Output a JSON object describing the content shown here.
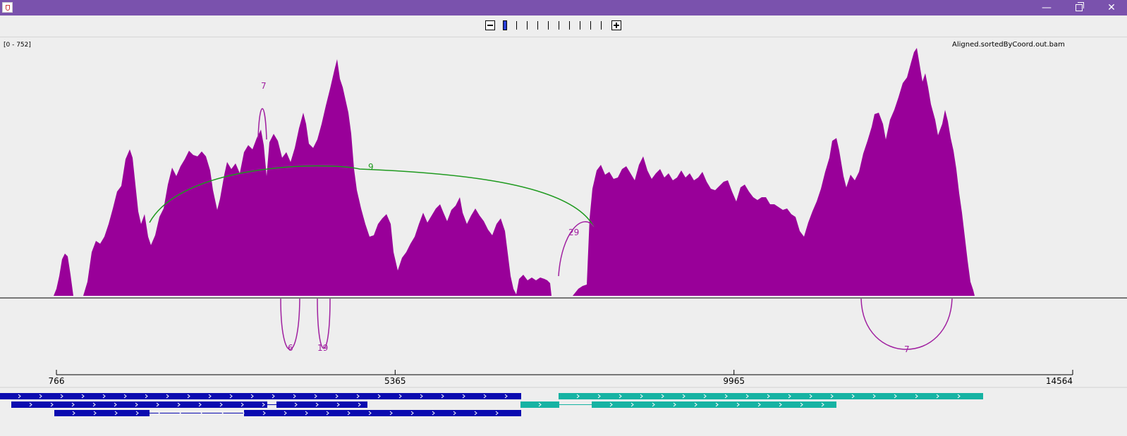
{
  "track": {
    "range_label": "[0 - 752]",
    "file_name": "Aligned.sortedByCoord.out.bam"
  },
  "ruler": {
    "ticks": [
      {
        "value": 766,
        "label": "766"
      },
      {
        "value": 5365,
        "label": "5365"
      },
      {
        "value": 9965,
        "label": "9965"
      },
      {
        "value": 14564,
        "label": "14564"
      }
    ]
  },
  "junctions": {
    "above": [
      {
        "label": "7",
        "color": "#a020a0"
      },
      {
        "label": "9",
        "color": "#1f9a1f"
      },
      {
        "label": "29",
        "color": "#a020a0"
      }
    ],
    "below": [
      {
        "label": "6",
        "color": "#a020a0"
      },
      {
        "label": "19",
        "color": "#a020a0"
      },
      {
        "label": "7",
        "color": "#a020a0"
      }
    ]
  },
  "colors": {
    "title_bar": "#7a52ad",
    "coverage": "#990099",
    "gene_forward": "#0b0bb0",
    "gene_other": "#16b3a3",
    "zoom_selected": "#2a3fd6"
  },
  "icons": {
    "app": "java-app-icon",
    "minimize": "minimize-icon",
    "maximize": "restore-icon",
    "close": "close-icon",
    "zoom_out": "minus-icon",
    "zoom_in": "plus-icon"
  },
  "window": {
    "minimize_glyph": "—",
    "close_glyph": "✕"
  }
}
